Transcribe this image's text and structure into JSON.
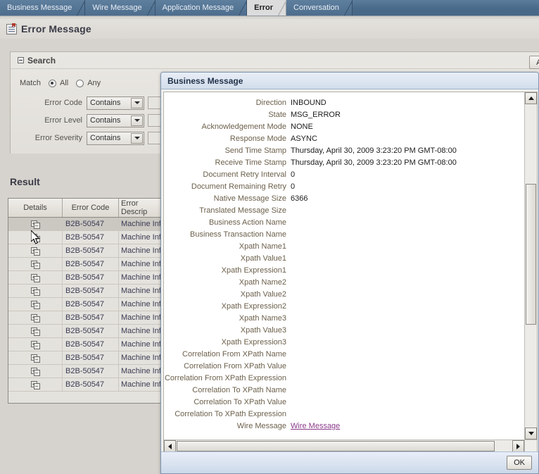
{
  "tabs": [
    {
      "label": "Business Message",
      "active": false
    },
    {
      "label": "Wire Message",
      "active": false
    },
    {
      "label": "Application Message",
      "active": false
    },
    {
      "label": "Error",
      "active": true
    },
    {
      "label": "Conversation",
      "active": false
    }
  ],
  "page": {
    "title": "Error Message",
    "icon": "report-icon"
  },
  "search": {
    "title": "Search",
    "advanced_label": "Advanced",
    "match_label": "Match",
    "match_options": [
      {
        "label": "All",
        "selected": true
      },
      {
        "label": "Any",
        "selected": false
      }
    ],
    "fields": [
      {
        "label": "Error Code",
        "operator": "Contains",
        "value": ""
      },
      {
        "label": "Error Level",
        "operator": "Contains",
        "value": ""
      },
      {
        "label": "Error Severity",
        "operator": "Contains",
        "value": ""
      }
    ]
  },
  "result": {
    "title": "Result",
    "columns": [
      "Details",
      "Error Code",
      "Error Descrip"
    ],
    "rows": [
      {
        "error_code": "B2B-50547",
        "error_description": "Machine Info",
        "selected": true
      },
      {
        "error_code": "B2B-50547",
        "error_description": "Machine Info",
        "selected": false
      },
      {
        "error_code": "B2B-50547",
        "error_description": "Machine Info",
        "selected": false
      },
      {
        "error_code": "B2B-50547",
        "error_description": "Machine Info",
        "selected": false
      },
      {
        "error_code": "B2B-50547",
        "error_description": "Machine Info",
        "selected": false
      },
      {
        "error_code": "B2B-50547",
        "error_description": "Machine Info",
        "selected": false
      },
      {
        "error_code": "B2B-50547",
        "error_description": "Machine Info",
        "selected": false
      },
      {
        "error_code": "B2B-50547",
        "error_description": "Machine Info",
        "selected": false
      },
      {
        "error_code": "B2B-50547",
        "error_description": "Machine Info",
        "selected": false
      },
      {
        "error_code": "B2B-50547",
        "error_description": "Machine Info",
        "selected": false
      },
      {
        "error_code": "B2B-50547",
        "error_description": "Machine Info",
        "selected": false
      },
      {
        "error_code": "B2B-50547",
        "error_description": "Machine Info",
        "selected": false
      },
      {
        "error_code": "B2B-50547",
        "error_description": "Machine Info",
        "selected": false
      }
    ]
  },
  "dialog": {
    "title": "Business Message",
    "ok_label": "OK",
    "properties": [
      {
        "label": "Direction",
        "value": "INBOUND",
        "link": false
      },
      {
        "label": "State",
        "value": "MSG_ERROR",
        "link": false
      },
      {
        "label": "Acknowledgement Mode",
        "value": "NONE",
        "link": false
      },
      {
        "label": "Response Mode",
        "value": "ASYNC",
        "link": false
      },
      {
        "label": "Send Time Stamp",
        "value": "Thursday, April 30, 2009 3:23:20 PM GMT-08:00",
        "link": false
      },
      {
        "label": "Receive Time Stamp",
        "value": "Thursday, April 30, 2009 3:23:20 PM GMT-08:00",
        "link": false
      },
      {
        "label": "Document Retry Interval",
        "value": "0",
        "link": false
      },
      {
        "label": "Document Remaining Retry",
        "value": "0",
        "link": false
      },
      {
        "label": "Native Message Size",
        "value": "6366",
        "link": false
      },
      {
        "label": "Translated Message Size",
        "value": "",
        "link": false
      },
      {
        "label": "Business Action Name",
        "value": "",
        "link": false
      },
      {
        "label": "Business Transaction Name",
        "value": "",
        "link": false
      },
      {
        "label": "Xpath Name1",
        "value": "",
        "link": false
      },
      {
        "label": "Xpath Value1",
        "value": "",
        "link": false
      },
      {
        "label": "Xpath Expression1",
        "value": "",
        "link": false
      },
      {
        "label": "Xpath Name2",
        "value": "",
        "link": false
      },
      {
        "label": "Xpath Value2",
        "value": "",
        "link": false
      },
      {
        "label": "Xpath Expression2",
        "value": "",
        "link": false
      },
      {
        "label": "Xpath Name3",
        "value": "",
        "link": false
      },
      {
        "label": "Xpath Value3",
        "value": "",
        "link": false
      },
      {
        "label": "Xpath Expression3",
        "value": "",
        "link": false
      },
      {
        "label": "Correlation From XPath Name",
        "value": "",
        "link": false
      },
      {
        "label": "Correlation From XPath Value",
        "value": "",
        "link": false
      },
      {
        "label": "Correlation From XPath Expression",
        "value": "",
        "link": false
      },
      {
        "label": "Correlation To XPath Name",
        "value": "",
        "link": false
      },
      {
        "label": "Correlation To XPath Value",
        "value": "",
        "link": false
      },
      {
        "label": "Correlation To XPath Expression",
        "value": "",
        "link": false
      },
      {
        "label": "Wire Message",
        "value": "Wire Message",
        "link": true
      }
    ]
  },
  "colors": {
    "tabbar": "#4a6a8a",
    "link": "#8b3a8b",
    "label_text": "#6b5f4a",
    "dialog_title_bg": "#d2ddeb"
  }
}
